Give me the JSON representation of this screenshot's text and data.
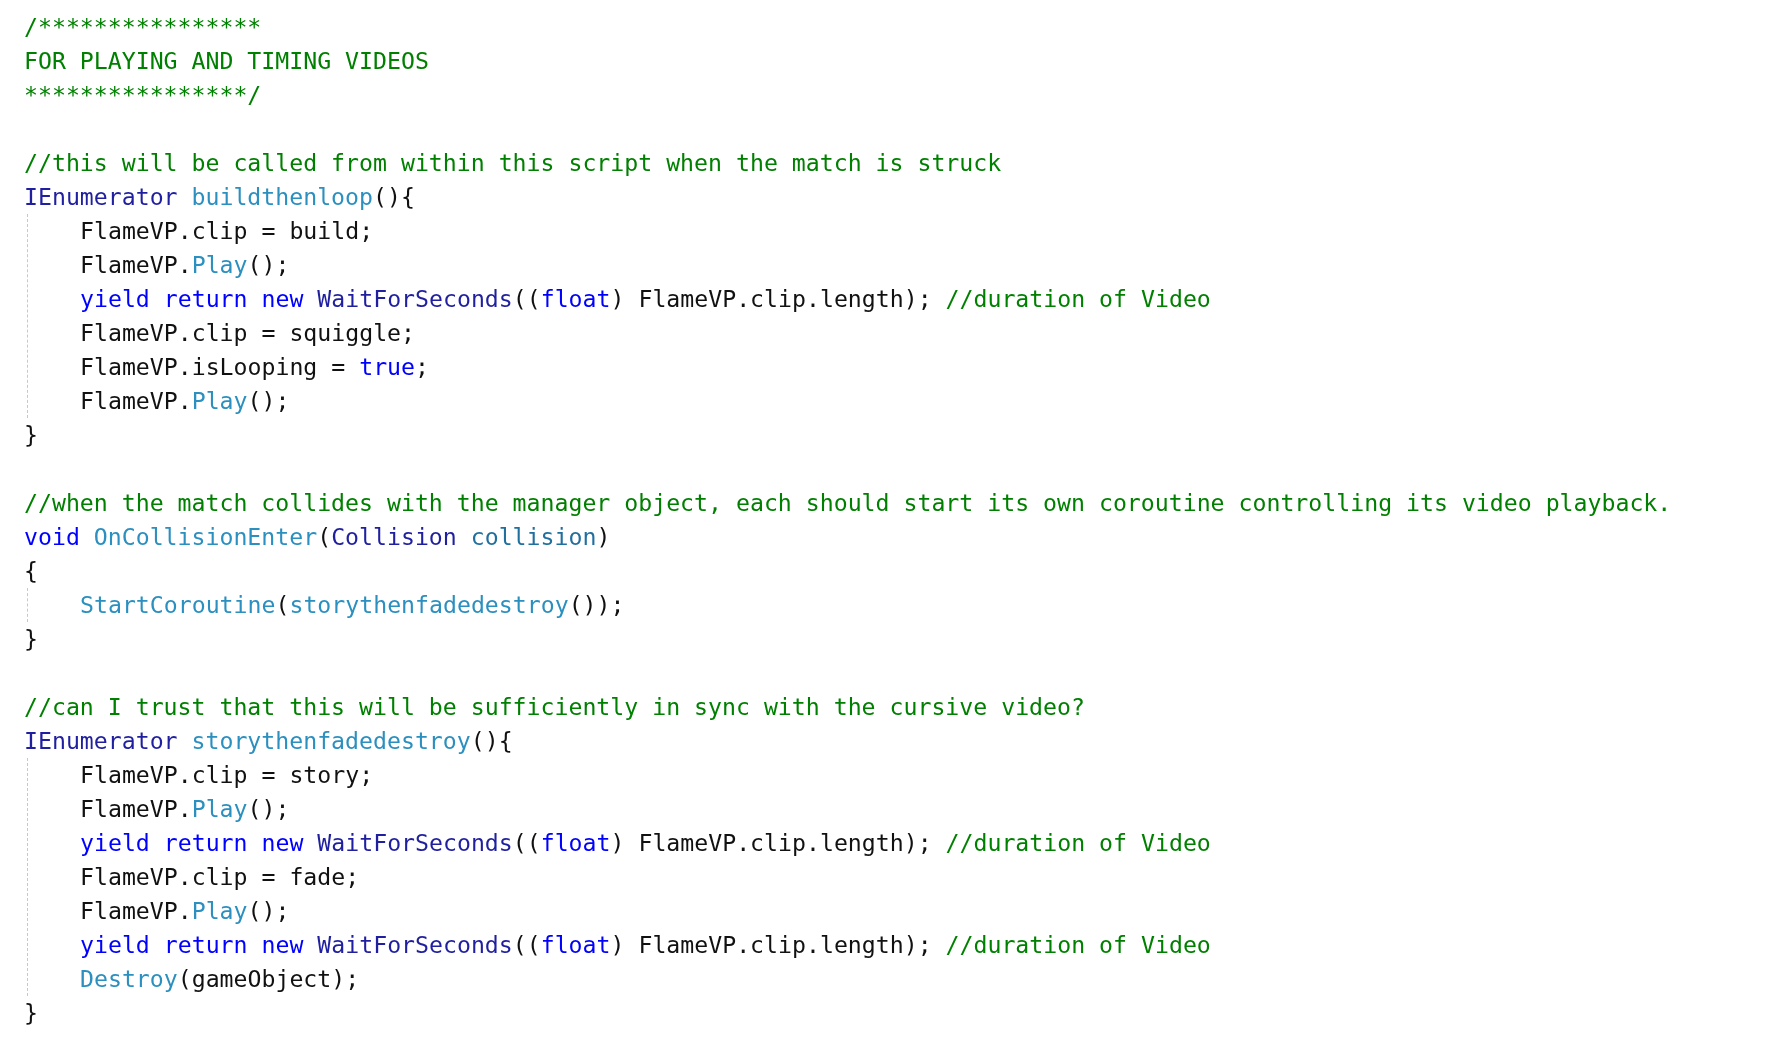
{
  "lines": [
    {
      "kind": "code",
      "tokens": [
        {
          "kind": "comment",
          "text": "/****************"
        }
      ]
    },
    {
      "kind": "code",
      "tokens": [
        {
          "kind": "comment",
          "text": "FOR PLAYING AND TIMING VIDEOS"
        }
      ]
    },
    {
      "kind": "code",
      "tokens": [
        {
          "kind": "comment",
          "text": "****************/"
        }
      ]
    },
    {
      "kind": "blank"
    },
    {
      "kind": "code",
      "tokens": [
        {
          "kind": "comment",
          "text": "//this will be called from within this script when the match is struck"
        }
      ]
    },
    {
      "kind": "code",
      "tokens": [
        {
          "kind": "type",
          "text": "IEnumerator"
        },
        {
          "kind": "method",
          "text": " buildthenloop"
        },
        {
          "kind": "plain",
          "text": "(){"
        }
      ],
      "children": [
        {
          "kind": "code",
          "tokens": [
            {
              "kind": "plain",
              "text": "FlameVP.clip = build;"
            }
          ]
        },
        {
          "kind": "code",
          "tokens": [
            {
              "kind": "plain",
              "text": "FlameVP."
            },
            {
              "kind": "method",
              "text": "Play"
            },
            {
              "kind": "plain",
              "text": "();"
            }
          ]
        },
        {
          "kind": "code",
          "tokens": [
            {
              "kind": "keyword",
              "text": "yield return new"
            },
            {
              "kind": "type",
              "text": " WaitForSeconds"
            },
            {
              "kind": "plain",
              "text": "(("
            },
            {
              "kind": "keyword",
              "text": "float"
            },
            {
              "kind": "plain",
              "text": ") FlameVP.clip.length); "
            },
            {
              "kind": "comment",
              "text": "//duration of Video"
            }
          ]
        },
        {
          "kind": "code",
          "tokens": [
            {
              "kind": "plain",
              "text": "FlameVP.clip = squiggle;"
            }
          ]
        },
        {
          "kind": "code",
          "tokens": [
            {
              "kind": "plain",
              "text": "FlameVP.isLooping = "
            },
            {
              "kind": "keyword",
              "text": "true"
            },
            {
              "kind": "plain",
              "text": ";"
            }
          ]
        },
        {
          "kind": "code",
          "tokens": [
            {
              "kind": "plain",
              "text": "FlameVP."
            },
            {
              "kind": "method",
              "text": "Play"
            },
            {
              "kind": "plain",
              "text": "();"
            }
          ]
        }
      ]
    },
    {
      "kind": "code",
      "tokens": [
        {
          "kind": "plain",
          "text": "}"
        }
      ]
    },
    {
      "kind": "blank"
    },
    {
      "kind": "code",
      "tokens": [
        {
          "kind": "comment",
          "text": "//when the match collides with the manager object, each should start its own coroutine controlling its video playback."
        }
      ]
    },
    {
      "kind": "code",
      "tokens": [
        {
          "kind": "keyword",
          "text": "void"
        },
        {
          "kind": "method",
          "text": " OnCollisionEnter"
        },
        {
          "kind": "plain",
          "text": "("
        },
        {
          "kind": "type",
          "text": "Collision"
        },
        {
          "kind": "param",
          "text": " collision"
        },
        {
          "kind": "plain",
          "text": ")"
        }
      ]
    },
    {
      "kind": "code",
      "tokens": [
        {
          "kind": "plain",
          "text": "{"
        }
      ],
      "children": [
        {
          "kind": "code",
          "tokens": [
            {
              "kind": "method",
              "text": "StartCoroutine"
            },
            {
              "kind": "plain",
              "text": "("
            },
            {
              "kind": "method",
              "text": "storythenfadedestroy"
            },
            {
              "kind": "plain",
              "text": "());"
            }
          ]
        }
      ]
    },
    {
      "kind": "code",
      "tokens": [
        {
          "kind": "plain",
          "text": "}"
        }
      ]
    },
    {
      "kind": "blank"
    },
    {
      "kind": "code",
      "tokens": [
        {
          "kind": "comment",
          "text": "//can I trust that this will be sufficiently in sync with the cursive video?"
        }
      ]
    },
    {
      "kind": "code",
      "tokens": [
        {
          "kind": "type",
          "text": "IEnumerator"
        },
        {
          "kind": "method",
          "text": " storythenfadedestroy"
        },
        {
          "kind": "plain",
          "text": "(){"
        }
      ],
      "children": [
        {
          "kind": "code",
          "tokens": [
            {
              "kind": "plain",
              "text": "FlameVP.clip = story;"
            }
          ]
        },
        {
          "kind": "code",
          "tokens": [
            {
              "kind": "plain",
              "text": "FlameVP."
            },
            {
              "kind": "method",
              "text": "Play"
            },
            {
              "kind": "plain",
              "text": "();"
            }
          ]
        },
        {
          "kind": "code",
          "tokens": [
            {
              "kind": "keyword",
              "text": "yield return new"
            },
            {
              "kind": "type",
              "text": " WaitForSeconds"
            },
            {
              "kind": "plain",
              "text": "(("
            },
            {
              "kind": "keyword",
              "text": "float"
            },
            {
              "kind": "plain",
              "text": ") FlameVP.clip.length); "
            },
            {
              "kind": "comment",
              "text": "//duration of Video"
            }
          ]
        },
        {
          "kind": "code",
          "tokens": [
            {
              "kind": "plain",
              "text": "FlameVP.clip = fade;"
            }
          ]
        },
        {
          "kind": "code",
          "tokens": [
            {
              "kind": "plain",
              "text": "FlameVP."
            },
            {
              "kind": "method",
              "text": "Play"
            },
            {
              "kind": "plain",
              "text": "();"
            }
          ]
        },
        {
          "kind": "code",
          "tokens": [
            {
              "kind": "keyword",
              "text": "yield return new"
            },
            {
              "kind": "type",
              "text": " WaitForSeconds"
            },
            {
              "kind": "plain",
              "text": "(("
            },
            {
              "kind": "keyword",
              "text": "float"
            },
            {
              "kind": "plain",
              "text": ") FlameVP.clip.length); "
            },
            {
              "kind": "comment",
              "text": "//duration of Video"
            }
          ]
        },
        {
          "kind": "code",
          "tokens": [
            {
              "kind": "method",
              "text": "Destroy"
            },
            {
              "kind": "plain",
              "text": "(gameObject);"
            }
          ]
        }
      ]
    },
    {
      "kind": "code",
      "tokens": [
        {
          "kind": "plain",
          "text": "}"
        }
      ]
    }
  ]
}
